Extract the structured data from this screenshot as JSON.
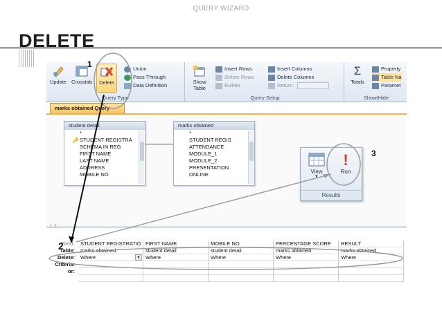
{
  "slide": {
    "header": "QUERY WIZARD",
    "title": "DELETE"
  },
  "ribbon": {
    "query_type": {
      "label": "Query Type",
      "buttons": [
        "Update",
        "Crosstab",
        "Delete"
      ],
      "small": [
        "Union",
        "Pass-Through",
        "Data Definition"
      ]
    },
    "query_setup": {
      "label": "Query Setup",
      "show_table": "Show Table",
      "col1": [
        "Insert Rows",
        "Delete Rows",
        "Builder"
      ],
      "col2": [
        "Insert Columns",
        "Delete Columns",
        "Return:"
      ]
    },
    "show_hide": {
      "label": "Show/Hide",
      "totals": "Totals",
      "items": [
        "Property",
        "Table Na",
        "Paramet"
      ]
    }
  },
  "document_tab": "marks obtained Query",
  "tables": {
    "student_detail": {
      "title": "student detail",
      "fields": [
        "*",
        "STUDENT REGISTRA",
        "SCHEMA IN REG",
        "FIRST NAME",
        "LAST NAME",
        "ADDRESS",
        "MOBILE NO"
      ]
    },
    "marks_obtained": {
      "title": "marks obtained",
      "fields": [
        "*",
        "STUDENT REGIS",
        "ATTENDANCE",
        "MODULE_1",
        "MODULE_2",
        "PRESENTATION",
        "ONLINE"
      ]
    }
  },
  "results": {
    "label": "Results",
    "view": "View",
    "run": "Run"
  },
  "grid": {
    "row_labels": [
      "Field:",
      "Table:",
      "Delete:",
      "Criteria:",
      "or:"
    ],
    "columns": [
      {
        "field": "STUDENT REGISTRATIO",
        "table": "marks obtained",
        "delete": "Where"
      },
      {
        "field": "FIRST NAME",
        "table": "student detail",
        "delete": "Where"
      },
      {
        "field": "MOBILE NO",
        "table": "student detail",
        "delete": "Where"
      },
      {
        "field": "PERCENTAGE SCORE",
        "table": "marks obtained",
        "delete": "Where"
      },
      {
        "field": "RESULT",
        "table": "marks obtained",
        "delete": "Where"
      }
    ]
  },
  "annotations": [
    "1",
    "2",
    "3"
  ],
  "colors": {
    "accent_tab": "#f7c35e",
    "ribbon_border": "#9fb0c6",
    "delete_icon": "#d64a2a",
    "run_icon": "#e03a1e"
  }
}
